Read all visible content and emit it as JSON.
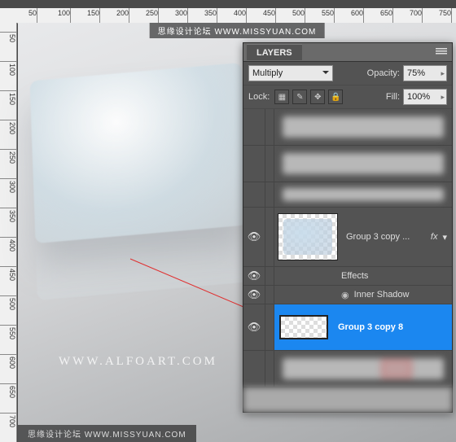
{
  "ruler_h": [
    "50",
    "100",
    "150",
    "200",
    "250",
    "300",
    "350",
    "400",
    "450",
    "500",
    "550",
    "600",
    "650",
    "700",
    "750"
  ],
  "ruler_v": [
    "50",
    "100",
    "150",
    "200",
    "250",
    "300",
    "350",
    "400",
    "450",
    "500",
    "550",
    "600",
    "650",
    "700"
  ],
  "watermark_top": "思缘设计论坛 WWW.MISSYUAN.COM",
  "watermark_bottom": "思缘设计论坛  WWW.MISSYUAN.COM",
  "site_url": "WWW.ALFOART.COM",
  "panel": {
    "tab_label": "LAYERS",
    "blend_mode": "Multiply",
    "opacity_label": "Opacity:",
    "opacity_value": "75%",
    "lock_label": "Lock:",
    "fill_label": "Fill:",
    "fill_value": "100%",
    "effects_label": "Effects",
    "inner_shadow_label": "Inner Shadow",
    "layer1_name": "Group 3 copy ...",
    "layer1_fx": "fx",
    "layer2_name": "Group 3 copy 8"
  }
}
